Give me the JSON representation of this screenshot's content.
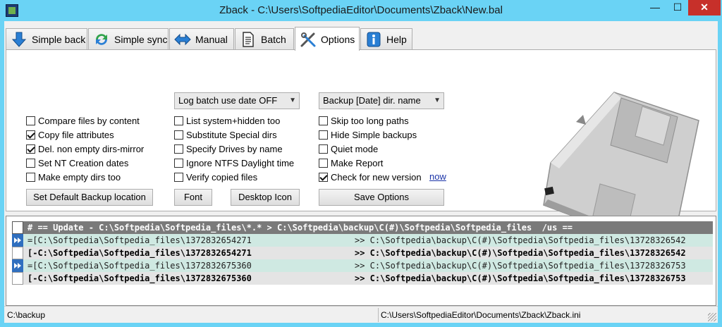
{
  "window": {
    "title": "Zback - C:\\Users\\SoftpediaEditor\\Documents\\Zback\\New.bal",
    "minimize_glyph": "—",
    "maximize_glyph": "☐",
    "close_glyph": "✕"
  },
  "tabs": [
    {
      "label": "Simple back",
      "icon": "down-arrow-icon"
    },
    {
      "label": "Simple sync",
      "icon": "sync-icon"
    },
    {
      "label": "Manual",
      "icon": "double-arrow-icon"
    },
    {
      "label": "Batch",
      "icon": "document-icon"
    },
    {
      "label": "Options",
      "icon": "tools-icon",
      "active": true
    },
    {
      "label": "Help",
      "icon": "info-icon"
    }
  ],
  "options": {
    "dropdown_log": "Log batch use date OFF",
    "dropdown_backup": "Backup [Date] dir. name",
    "col1": [
      {
        "label": "Compare files by content",
        "checked": false
      },
      {
        "label": "Copy file attributes",
        "checked": true
      },
      {
        "label": "Del. non empty dirs-mirror",
        "checked": true
      },
      {
        "label": "Set NT Creation dates",
        "checked": false
      },
      {
        "label": "Make empty dirs too",
        "checked": false
      }
    ],
    "col2": [
      {
        "label": "List system+hidden too",
        "checked": false
      },
      {
        "label": "Substitute Special dirs",
        "checked": false
      },
      {
        "label": "Specify Drives by name",
        "checked": false
      },
      {
        "label": "Ignore NTFS Daylight time",
        "checked": false
      },
      {
        "label": "Verify copied files",
        "checked": false
      }
    ],
    "col3": [
      {
        "label": "Skip too long paths",
        "checked": false
      },
      {
        "label": "Hide Simple backups",
        "checked": false
      },
      {
        "label": "Quiet mode",
        "checked": false
      },
      {
        "label": "Make Report",
        "checked": false
      },
      {
        "label": "Check for new version",
        "checked": true
      }
    ],
    "now_link": "now",
    "btn_default_backup": "Set Default Backup location",
    "btn_font": "Font",
    "btn_desktop_icon": "Desktop Icon",
    "btn_save": "Save Options"
  },
  "log": {
    "header": "# == Update - C:\\Softpedia\\Softpedia_files\\*.* > C:\\Softpedia\\backup\\C(#)\\Softpedia\\Softpedia_files  /us ==",
    "rows": [
      {
        "left": "=[C:\\Softpedia\\Softpedia_files\\1372832654271",
        "right": ">> C:\\Softpedia\\backup\\C(#)\\Softpedia\\Softpedia_files\\13728326542",
        "style": "green"
      },
      {
        "left": "[-C:\\Softpedia\\Softpedia_files\\1372832654271",
        "right": ">> C:\\Softpedia\\backup\\C(#)\\Softpedia\\Softpedia_files\\13728326542",
        "style": "gray"
      },
      {
        "left": "=[C:\\Softpedia\\Softpedia_files\\1372832675360",
        "right": ">> C:\\Softpedia\\backup\\C(#)\\Softpedia\\Softpedia_files\\13728326753",
        "style": "green"
      },
      {
        "left": "[-C:\\Softpedia\\Softpedia_files\\1372832675360",
        "right": ">> C:\\Softpedia\\backup\\C(#)\\Softpedia\\Softpedia_files\\13728326753",
        "style": "gray"
      }
    ]
  },
  "status": {
    "left": "C:\\backup",
    "right": "C:\\Users\\SoftpediaEditor\\Documents\\Zback\\Zback.ini"
  },
  "colors": {
    "titlebar": "#6ad3f5",
    "close_button": "#c7302a",
    "log_header": "#7a7a7a",
    "log_green_row": "#cfe9e2",
    "log_gray_row": "#e4e4e4",
    "play_box": "#2f6fbf"
  }
}
